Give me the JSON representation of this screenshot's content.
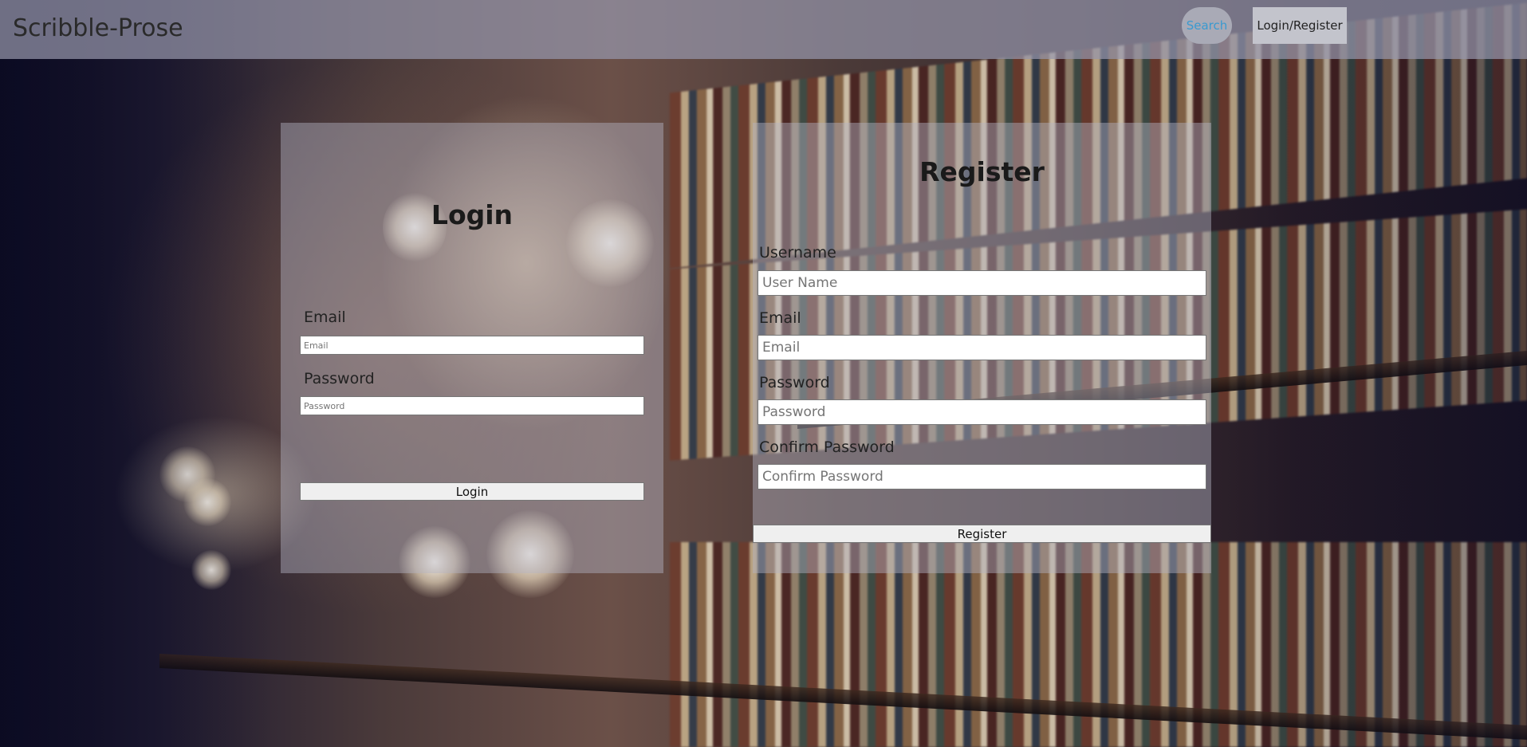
{
  "nav": {
    "brand": "Scribble-Prose",
    "search_label": "Search",
    "login_register_label": "Login/Register"
  },
  "login": {
    "title": "Login",
    "email_label": "Email",
    "email_placeholder": "Email",
    "password_label": "Password",
    "password_placeholder": "Password",
    "submit_label": "Login"
  },
  "register": {
    "title": "Register",
    "username_label": "Username",
    "username_placeholder": "User Name",
    "email_label": "Email",
    "email_placeholder": "Email",
    "password_label": "Password",
    "password_placeholder": "Password",
    "confirm_label": "Confirm Password",
    "confirm_placeholder": "Confirm Password",
    "submit_label": "Register"
  },
  "colors": {
    "navbar": "#9696aa",
    "search_text": "#3a9ad0"
  }
}
